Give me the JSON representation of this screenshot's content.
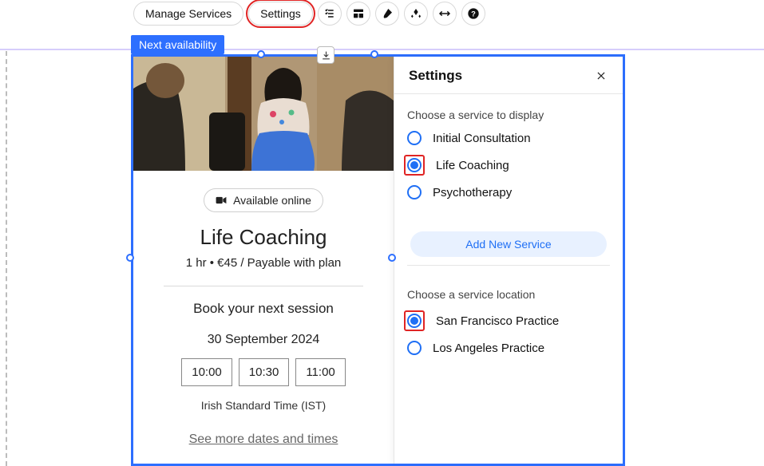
{
  "toolbar": {
    "manage_label": "Manage Services",
    "settings_label": "Settings"
  },
  "na_tag": "Next availability",
  "card": {
    "avail_badge": "Available online",
    "title": "Life Coaching",
    "meta": "1 hr • €45 / Payable with plan",
    "book_next": "Book your next session",
    "date": "30 September 2024",
    "slots": [
      "10:00",
      "10:30",
      "11:00"
    ],
    "tz": "Irish Standard Time (IST)",
    "see_more": "See more dates and times"
  },
  "settings": {
    "title": "Settings",
    "service_section_label": "Choose a service to display",
    "services": [
      {
        "label": "Initial Consultation",
        "selected": false,
        "highlight": false
      },
      {
        "label": "Life Coaching",
        "selected": true,
        "highlight": true
      },
      {
        "label": "Psychotherapy",
        "selected": false,
        "highlight": false
      }
    ],
    "add_new_service": "Add New Service",
    "location_section_label": "Choose a service location",
    "locations": [
      {
        "label": "San Francisco Practice",
        "selected": true,
        "highlight": true
      },
      {
        "label": "Los Angeles Practice",
        "selected": false,
        "highlight": false
      }
    ]
  }
}
